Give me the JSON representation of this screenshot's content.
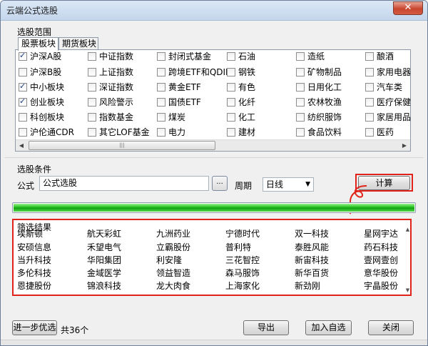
{
  "window": {
    "title": "云端公式选股",
    "close_label": "✕"
  },
  "scope_group": {
    "label": "选股范围",
    "tabs": [
      {
        "label": "股票板块",
        "active": true
      },
      {
        "label": "期货板块",
        "active": false
      }
    ],
    "columns": [
      [
        {
          "label": "沪深A股",
          "checked": true
        },
        {
          "label": "沪深B股",
          "checked": false
        },
        {
          "label": "中小板块",
          "checked": true
        },
        {
          "label": "创业板块",
          "checked": true
        },
        {
          "label": "科创板块",
          "checked": false
        },
        {
          "label": "沪伦通CDR",
          "checked": false
        }
      ],
      [
        {
          "label": "中证指数",
          "checked": false
        },
        {
          "label": "上证指数",
          "checked": false
        },
        {
          "label": "深证指数",
          "checked": false
        },
        {
          "label": "风险警示",
          "checked": false
        },
        {
          "label": "指数基金",
          "checked": false
        },
        {
          "label": "其它LOF基金",
          "checked": false
        }
      ],
      [
        {
          "label": "封闭式基金",
          "checked": false
        },
        {
          "label": "跨境ETF和QDII",
          "checked": false
        },
        {
          "label": "黄金ETF",
          "checked": false
        },
        {
          "label": "国债ETF",
          "checked": false
        },
        {
          "label": "煤炭",
          "checked": false
        },
        {
          "label": "电力",
          "checked": false
        }
      ],
      [
        {
          "label": "石油",
          "checked": false
        },
        {
          "label": "钢铁",
          "checked": false
        },
        {
          "label": "有色",
          "checked": false
        },
        {
          "label": "化纤",
          "checked": false
        },
        {
          "label": "化工",
          "checked": false
        },
        {
          "label": "建材",
          "checked": false
        }
      ],
      [
        {
          "label": "造纸",
          "checked": false
        },
        {
          "label": "矿物制品",
          "checked": false
        },
        {
          "label": "日用化工",
          "checked": false
        },
        {
          "label": "农林牧渔",
          "checked": false
        },
        {
          "label": "纺织服饰",
          "checked": false
        },
        {
          "label": "食品饮料",
          "checked": false
        }
      ],
      [
        {
          "label": "酿酒",
          "checked": false
        },
        {
          "label": "家用电器",
          "checked": false
        },
        {
          "label": "汽车类",
          "checked": false
        },
        {
          "label": "医疗保健",
          "checked": false
        },
        {
          "label": "家居用品",
          "checked": false
        },
        {
          "label": "医药",
          "checked": false
        }
      ]
    ],
    "scroll_thumb_glyph": "|||"
  },
  "condition_group": {
    "label": "选股条件",
    "formula_label": "公式",
    "formula_value": "公式选股",
    "browse_label": "...",
    "period_label": "周期",
    "period_value": "日线",
    "calc_label": "计算"
  },
  "progress": {
    "fraction": 1.0
  },
  "results": {
    "label": "筛选结果",
    "rows": [
      [
        "埃斯顿",
        "航天彩虹",
        "九洲药业",
        "宁德时代",
        "双一科技",
        "星网宇达"
      ],
      [
        "安硕信息",
        "禾望电气",
        "立霸股份",
        "普利特",
        "泰胜风能",
        "药石科技"
      ],
      [
        "当升科技",
        "华阳集团",
        "利安隆",
        "三花智控",
        "新宙科技",
        "壹网壹创"
      ],
      [
        "多伦科技",
        "金域医学",
        "领益智造",
        "森马服饰",
        "新华百货",
        "意华股份"
      ],
      [
        "恩捷股份",
        "锦浪科技",
        "龙大肉食",
        "上海家化",
        "新劲刚",
        "宇晶股份"
      ]
    ]
  },
  "footer": {
    "further_label": "进一步优选",
    "count_text": "共36个",
    "export_label": "导出",
    "add_label": "加入自选",
    "close_label": "关闭"
  },
  "colors": {
    "highlight_frame": "#e0241b",
    "progress_green": "#22c21f"
  }
}
